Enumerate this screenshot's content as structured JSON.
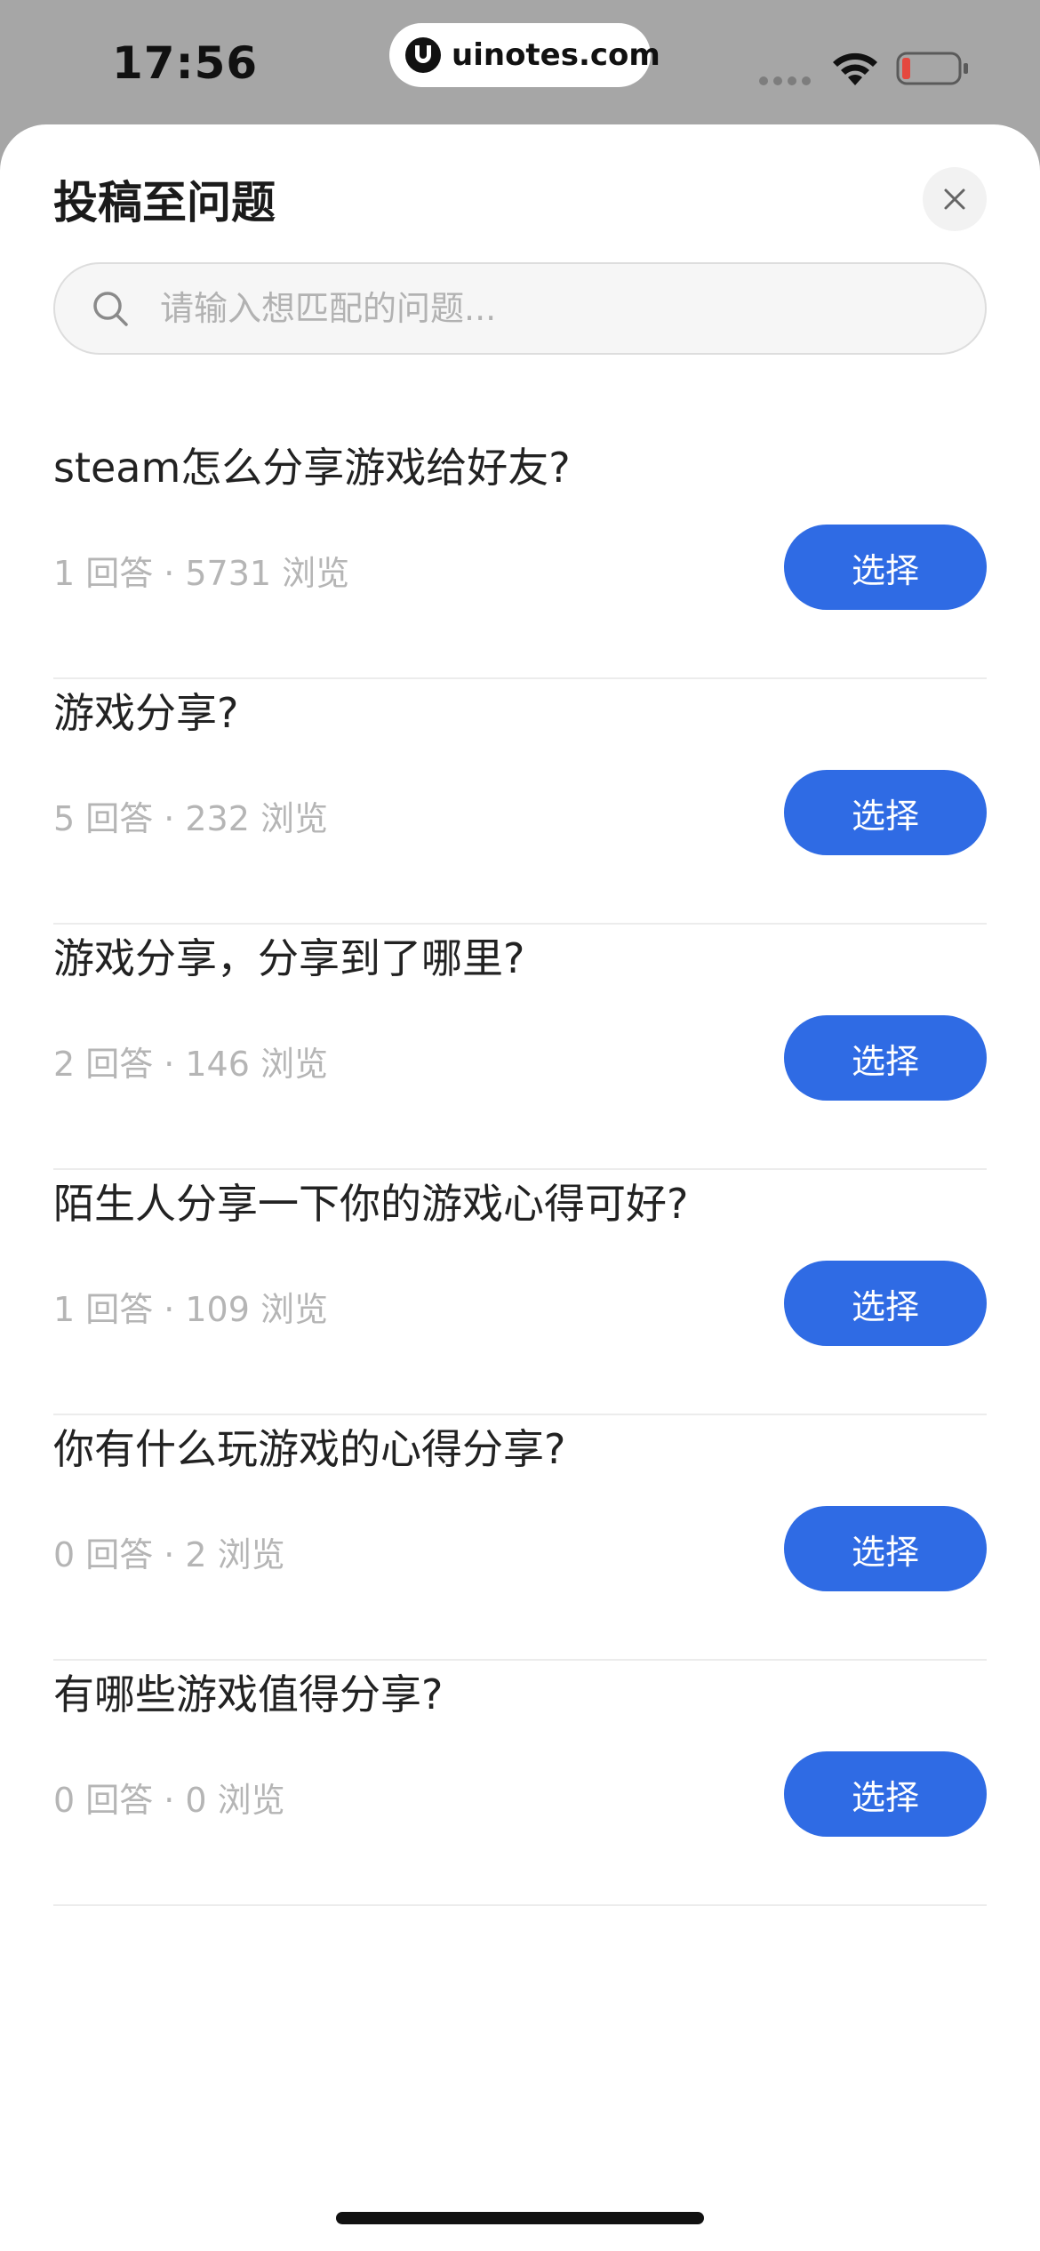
{
  "status_bar": {
    "time": "17:56",
    "url": "uinotes.com",
    "icons": [
      "signal-icon",
      "wifi-icon",
      "battery-icon"
    ],
    "battery_color": "#e5483f"
  },
  "sheet": {
    "title": "投稿至问题",
    "close_icon": "close-icon"
  },
  "search": {
    "placeholder": "请输入想匹配的问题...",
    "value": ""
  },
  "colors": {
    "accent": "#2f6be4",
    "meta_text": "#b5b5b5"
  },
  "questions": [
    {
      "title": "steam怎么分享游戏给好友?",
      "answers": "1 回答",
      "separator": "·",
      "views": "5731 浏览",
      "button": "选择"
    },
    {
      "title": "游戏分享?",
      "answers": "5 回答",
      "separator": "·",
      "views": "232 浏览",
      "button": "选择"
    },
    {
      "title": "游戏分享，分享到了哪里?",
      "answers": "2 回答",
      "separator": "·",
      "views": "146 浏览",
      "button": "选择"
    },
    {
      "title": "陌生人分享一下你的游戏心得可好?",
      "answers": "1 回答",
      "separator": "·",
      "views": "109 浏览",
      "button": "选择"
    },
    {
      "title": "你有什么玩游戏的心得分享?",
      "answers": "0 回答",
      "separator": "·",
      "views": "2 浏览",
      "button": "选择"
    },
    {
      "title": "有哪些游戏值得分享?",
      "answers": "0 回答",
      "separator": "·",
      "views": "0 浏览",
      "button": "选择"
    }
  ]
}
